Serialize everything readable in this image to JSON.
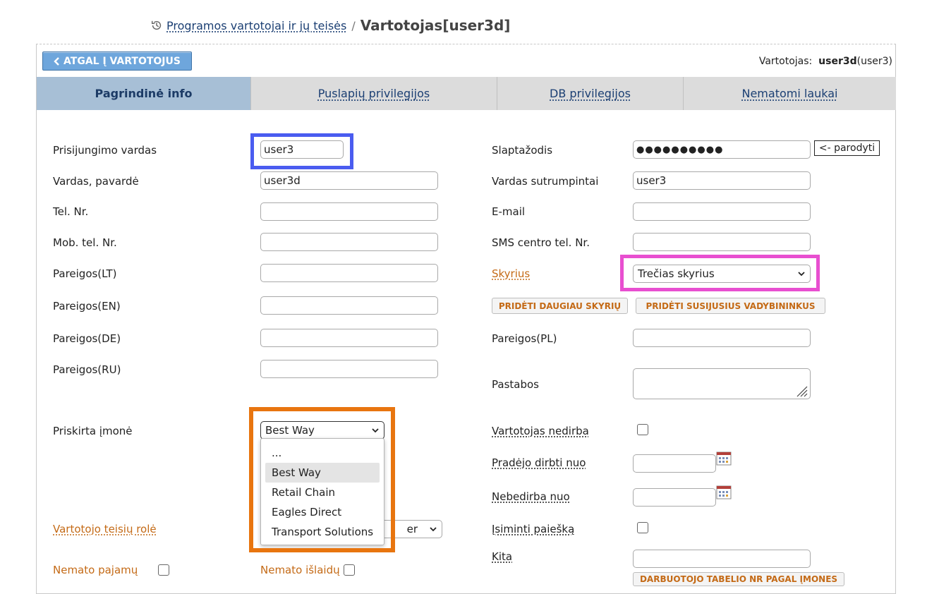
{
  "breadcrumb": {
    "link": "Programos vartotojai ir jų teisės",
    "separator": "/",
    "current": "Vartotojas[user3d]"
  },
  "toolbar": {
    "back_label": "ATGAL Į VARTOTOJUS",
    "user_label": "Vartotojas:",
    "user_name": "user3d",
    "user_login": "(user3)"
  },
  "tabs": [
    {
      "label": "Pagrindinė info"
    },
    {
      "label": "Puslapių privilegijos"
    },
    {
      "label": "DB privilegijos"
    },
    {
      "label": "Nematomi laukai"
    }
  ],
  "left": {
    "login_label": "Prisijungimo vardas",
    "login_value": "user3",
    "name_label": "Vardas, pavardė",
    "name_value": "user3d",
    "tel_label": "Tel. Nr.",
    "tel_value": "",
    "mob_label": "Mob. tel. Nr.",
    "mob_value": "",
    "pos_lt_label": "Pareigos(LT)",
    "pos_lt_value": "",
    "pos_en_label": "Pareigos(EN)",
    "pos_en_value": "",
    "pos_de_label": "Pareigos(DE)",
    "pos_de_value": "",
    "pos_ru_label": "Pareigos(RU)",
    "pos_ru_value": "",
    "company_label": "Priskirta įmonė",
    "company_value": "Best Way",
    "company_options": [
      "...",
      "Best Way",
      "Retail Chain",
      "Eagles Direct",
      "Transport Solutions"
    ],
    "role_label": "Vartotojo teisių rolė",
    "role_value_fragment": "er",
    "no_income_label": "Nemato pajamų",
    "no_expense_label": "Nemato išlaidų"
  },
  "right": {
    "password_label": "Slaptažodis",
    "password_value": "●●●●●●●●●●",
    "show_label": "<- parodyti",
    "short_name_label": "Vardas sutrumpintai",
    "short_name_value": "user3",
    "email_label": "E-mail",
    "email_value": "",
    "sms_label": "SMS centro tel. Nr.",
    "sms_value": "",
    "department_label": "Skyrius",
    "department_value": "Trečias skyrius",
    "add_departments_label": "PRIDĖTI DAUGIAU SKYRIŲ",
    "add_managers_label": "PRIDĖTI SUSIJUSIUS VADYBININKUS",
    "pos_pl_label": "Pareigos(PL)",
    "pos_pl_value": "",
    "notes_label": "Pastabos",
    "notes_value": "",
    "not_working_label": "Vartotojas nedirba",
    "started_label": "Pradėjo dirbti nuo",
    "started_value": "",
    "stopped_label": "Nebedirba nuo",
    "stopped_value": "",
    "remember_search_label": "Įsiminti paiešką",
    "other_label": "Kita",
    "other_value": "",
    "employee_table_label": "DARBUOTOJO TABELIO NR PAGAL ĮMONES"
  },
  "colors": {
    "accent_blue": "#4a5cf0",
    "highlight_magenta": "#e84fd0",
    "highlight_orange": "#e8750f",
    "link_orange": "#c46a16",
    "tab_active": "#a7bfd6",
    "tab_inactive": "#dcdcdc",
    "back_button": "#6ea6dc"
  },
  "icons": {
    "history": "history-icon",
    "chevron": "chevron-left-icon",
    "calendar": "calendar-icon",
    "dropdown": "chevron-down-icon"
  }
}
